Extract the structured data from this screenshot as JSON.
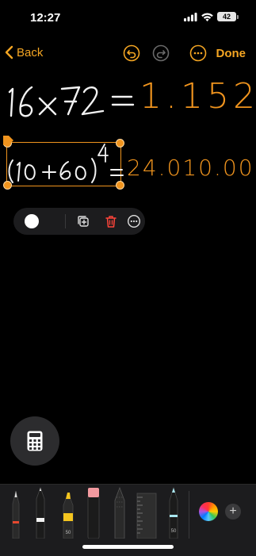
{
  "status_bar": {
    "time": "12:27",
    "battery": "42"
  },
  "nav": {
    "back_label": "Back",
    "done_label": "Done"
  },
  "canvas": {
    "line1_result": "1.152",
    "line2_result": "24.010.00",
    "line1_handwritten": "16×72=",
    "line2_handwritten": "(10+60)⁴="
  },
  "colors": {
    "accent": "#f5a623",
    "result": "#f0941e",
    "background": "#000000",
    "delete": "#ff453a"
  },
  "selection_toolbar": {
    "color_swatch": "white",
    "icons": [
      "duplicate-icon",
      "trash-icon",
      "more-icon"
    ]
  },
  "tool_tray": {
    "tools": [
      "pen",
      "fineliner",
      "marker",
      "eraser",
      "lasso",
      "ruler",
      "pencil"
    ],
    "tool_width_labels": {
      "marker": "50",
      "pencil": "50"
    }
  }
}
